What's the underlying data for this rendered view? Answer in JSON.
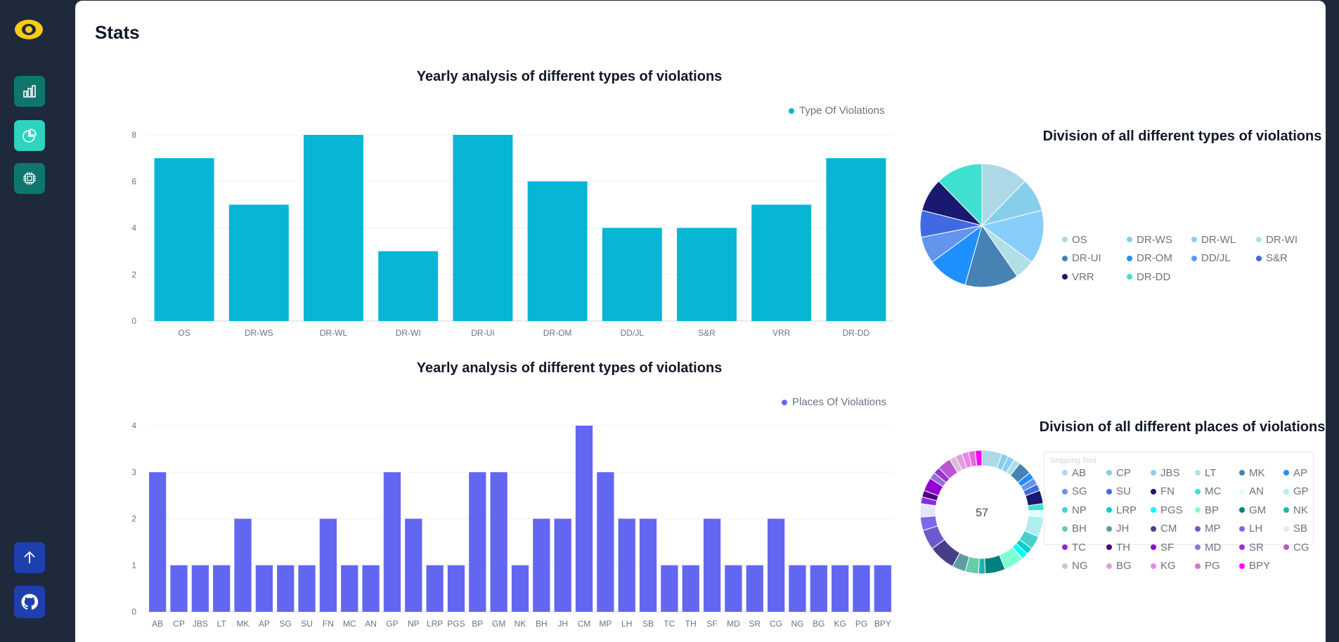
{
  "page": {
    "title": "Stats"
  },
  "sidebar": {
    "buttons": [
      {
        "name": "bar-chart",
        "icon": "bar-chart-icon",
        "active": false
      },
      {
        "name": "pie-chart",
        "icon": "pie-chart-icon",
        "active": true
      },
      {
        "name": "chip",
        "icon": "chip-icon",
        "active": false
      }
    ],
    "bottom": [
      {
        "name": "scroll-top",
        "icon": "arrow-up-icon"
      },
      {
        "name": "github",
        "icon": "github-icon"
      }
    ]
  },
  "colors": {
    "bar1": "#06b6d4",
    "bar2": "#6366f1",
    "teal": "#0f766e",
    "active": "#2dd4bf",
    "blue": "#1e40af"
  },
  "chart_data": [
    {
      "type": "bar",
      "title": "Yearly analysis of different types of violations",
      "legend": "Type Of Violations",
      "legend_position": "top-right",
      "categories": [
        "OS",
        "DR-WS",
        "DR-WL",
        "DR-WI",
        "DR-UI",
        "DR-OM",
        "DD/JL",
        "S&R",
        "VRR",
        "DR-DD"
      ],
      "values": [
        7,
        5,
        8,
        3,
        8,
        6,
        4,
        4,
        5,
        7
      ],
      "ylim": [
        0,
        8
      ],
      "yticks": [
        "0",
        "2",
        "4",
        "6",
        "8"
      ],
      "grid": true
    },
    {
      "type": "pie",
      "title": "Division of all different types of violations",
      "labels": [
        "OS",
        "DR-WS",
        "DR-WL",
        "DR-WI",
        "DR-UI",
        "DR-OM",
        "DD/JL",
        "S&R",
        "VRR",
        "DR-DD"
      ],
      "values": [
        7,
        5,
        8,
        3,
        8,
        6,
        4,
        4,
        5,
        7
      ],
      "colors": [
        "#add8e6",
        "#87ceeb",
        "#87cefa",
        "#b0e0e6",
        "#4682b4",
        "#1e90ff",
        "#6495ed",
        "#4169e1",
        "#191970",
        "#40e0d0"
      ]
    },
    {
      "type": "bar",
      "title": "Yearly analysis of different types of violations",
      "legend": "Places Of Violations",
      "legend_position": "top-right",
      "categories": [
        "AB",
        "CP",
        "JBS",
        "LT",
        "MK",
        "AP",
        "SG",
        "SU",
        "FN",
        "MC",
        "AN",
        "GP",
        "NP",
        "LRP",
        "PGS",
        "BP",
        "GM",
        "NK",
        "BH",
        "JH",
        "CM",
        "MP",
        "LH",
        "SB",
        "TC",
        "TH",
        "SF",
        "MD",
        "SR",
        "CG",
        "NG",
        "BG",
        "KG",
        "PG",
        "BPY"
      ],
      "values": [
        3,
        1,
        1,
        1,
        2,
        1,
        1,
        1,
        2,
        1,
        1,
        3,
        2,
        1,
        1,
        3,
        3,
        1,
        2,
        2,
        4,
        3,
        2,
        2,
        1,
        1,
        2,
        1,
        1,
        2,
        1,
        1,
        1,
        1,
        1
      ],
      "ylim": [
        0,
        4
      ],
      "yticks": [
        "0",
        "1",
        "2",
        "3",
        "4"
      ],
      "grid": true
    },
    {
      "type": "pie",
      "title": "Division of all different places of violations",
      "center_label": "57",
      "labels": [
        "AB",
        "CP",
        "JBS",
        "LT",
        "MK",
        "AP",
        "SG",
        "SU",
        "FN",
        "MC",
        "AN",
        "GP",
        "NP",
        "LRP",
        "PGS",
        "BP",
        "GM",
        "NK",
        "BH",
        "JH",
        "CM",
        "MP",
        "LH",
        "SB",
        "TC",
        "TH",
        "SF",
        "MD",
        "SR",
        "CG",
        "NG",
        "BG",
        "KG",
        "PG",
        "BPY"
      ],
      "values": [
        3,
        1,
        1,
        1,
        2,
        1,
        1,
        1,
        2,
        1,
        1,
        3,
        2,
        1,
        1,
        3,
        3,
        1,
        2,
        2,
        4,
        3,
        2,
        2,
        1,
        1,
        2,
        1,
        1,
        2,
        1,
        1,
        1,
        1,
        1
      ],
      "colors": [
        "#add8e6",
        "#87ceeb",
        "#87cefa",
        "#b0e0e6",
        "#4682b4",
        "#1e90ff",
        "#6495ed",
        "#4169e1",
        "#191970",
        "#40e0d0",
        "#e0ffff",
        "#afeeee",
        "#48d1cc",
        "#00ced1",
        "#00ffff",
        "#7fffd4",
        "#008080",
        "#20b2aa",
        "#66cdaa",
        "#5f9ea0",
        "#483d8b",
        "#6a5acd",
        "#7b68ee",
        "#e6e6fa",
        "#8a2be2",
        "#4b0082",
        "#9400d3",
        "#9370db",
        "#9932cc",
        "#ba55d3",
        "#d8bfd8",
        "#dda0dd",
        "#ee82ee",
        "#da70d6",
        "#ff00ff"
      ]
    }
  ],
  "tooltip": {
    "title": "Snipping Tool"
  }
}
